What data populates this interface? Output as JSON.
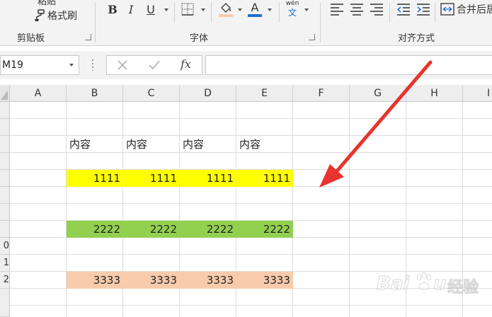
{
  "ribbon": {
    "clipboard": {
      "paste_label": "粘贴",
      "format_painter_label": "格式刷",
      "group_label": "剪贴板"
    },
    "font": {
      "bold_label": "B",
      "italic_label": "I",
      "underline_label": "U",
      "font_color_label": "A",
      "wen_top": "wén",
      "wen_char": "文",
      "group_label": "字体"
    },
    "alignment": {
      "merge_label": "合并后居",
      "group_label": "对齐方式"
    }
  },
  "formula_bar": {
    "name_box": "M19",
    "fx_label": "fx",
    "formula_value": ""
  },
  "columns": [
    "A",
    "B",
    "C",
    "D",
    "E",
    "F",
    "G",
    "H",
    "I"
  ],
  "rows": [
    "",
    "",
    "",
    "",
    "",
    "",
    "",
    "",
    "0",
    "1",
    "2",
    ""
  ],
  "cells": {
    "header_row": [
      "内容",
      "内容",
      "内容",
      "内容"
    ],
    "yellow_row": [
      "1111",
      "1111",
      "1111",
      "1111"
    ],
    "green_row": [
      "2222",
      "2222",
      "2222",
      "2222"
    ],
    "peach_row": [
      "3333",
      "3333",
      "3333",
      "3333"
    ]
  },
  "colors": {
    "yellow_fill": "#ffff00",
    "green_fill": "#92d050",
    "peach_fill": "#f8cbad",
    "arrow": "#e8332f"
  },
  "watermark": {
    "brand": "Bai",
    "brand_tail": "u",
    "cn": "经验"
  }
}
